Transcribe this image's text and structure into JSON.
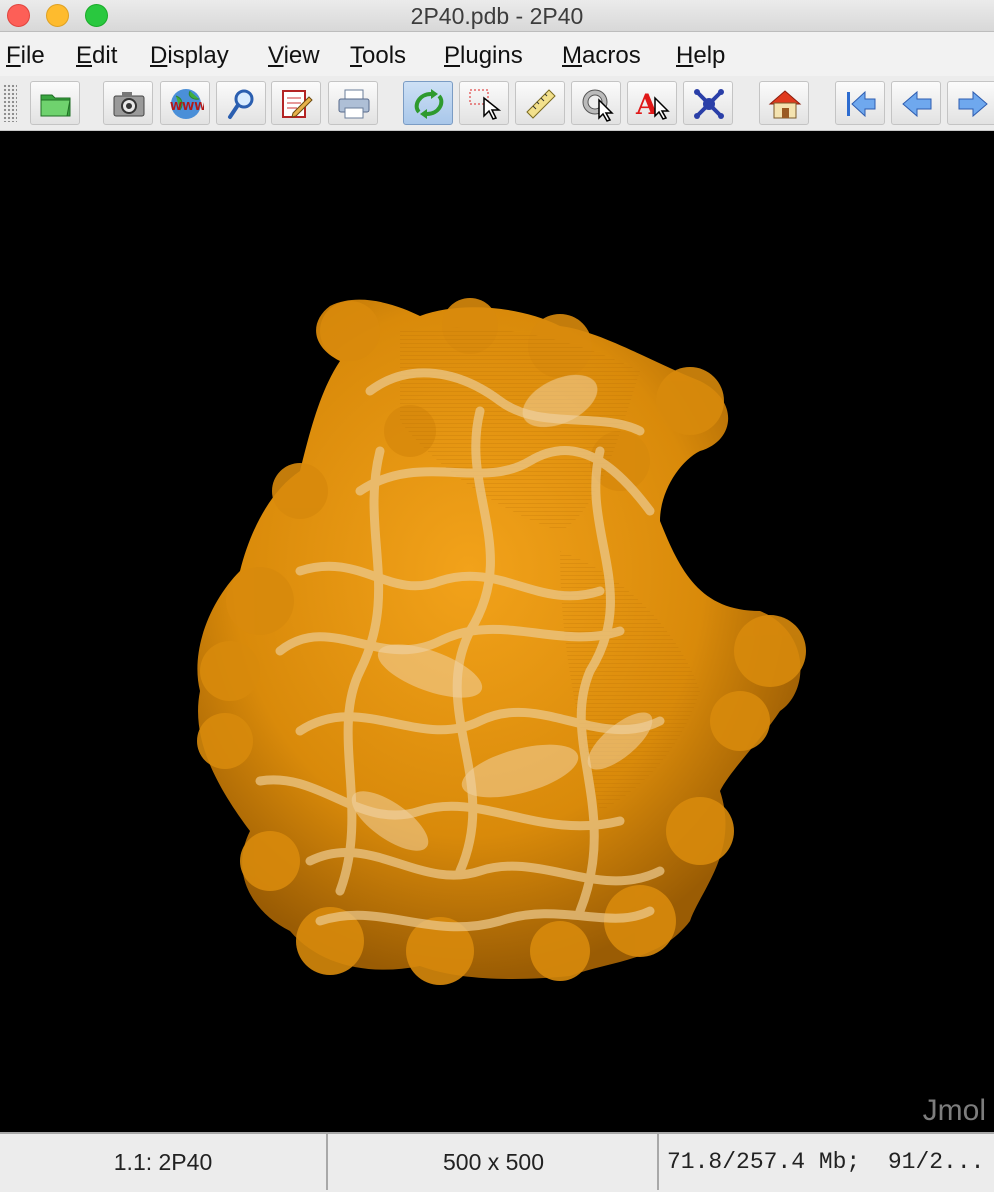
{
  "window": {
    "title": "2P40.pdb - 2P40"
  },
  "menu": [
    {
      "label": "File"
    },
    {
      "label": "Edit"
    },
    {
      "label": "Display"
    },
    {
      "label": "View"
    },
    {
      "label": "Tools"
    },
    {
      "label": "Plugins"
    },
    {
      "label": "Macros"
    },
    {
      "label": "Help"
    }
  ],
  "toolbar": [
    {
      "name": "open-file-button",
      "icon": "folder-icon"
    },
    {
      "name": "screenshot-button",
      "icon": "camera-icon"
    },
    {
      "name": "web-export-button",
      "icon": "www-globe-icon"
    },
    {
      "name": "script-editor-button",
      "icon": "magnifier-icon"
    },
    {
      "name": "edit-button",
      "icon": "notepad-pencil-icon"
    },
    {
      "name": "print-button",
      "icon": "printer-icon"
    },
    {
      "name": "rotate-button",
      "icon": "rotate-arrow-icon",
      "active": true
    },
    {
      "name": "pick-select-button",
      "icon": "selection-cursor-icon"
    },
    {
      "name": "measure-button",
      "icon": "ruler-icon"
    },
    {
      "name": "spin-pick-button",
      "icon": "target-cursor-icon"
    },
    {
      "name": "label-button",
      "icon": "text-a-cursor-icon"
    },
    {
      "name": "model-kit-button",
      "icon": "molecule-icon"
    },
    {
      "name": "home-button",
      "icon": "house-icon"
    },
    {
      "name": "first-frame-button",
      "icon": "arrow-first-icon"
    },
    {
      "name": "previous-frame-button",
      "icon": "arrow-left-icon"
    },
    {
      "name": "next-frame-button",
      "icon": "arrow-right-icon"
    }
  ],
  "viewer": {
    "watermark": "Jmol",
    "background": "#000000",
    "surface_color": "#d98c0a",
    "ribbon_color": "#e9c58a"
  },
  "status": {
    "model": "1.1: 2P40",
    "size": "500 x 500",
    "memory": "71.8/257.4 Mb;  91/2..."
  }
}
